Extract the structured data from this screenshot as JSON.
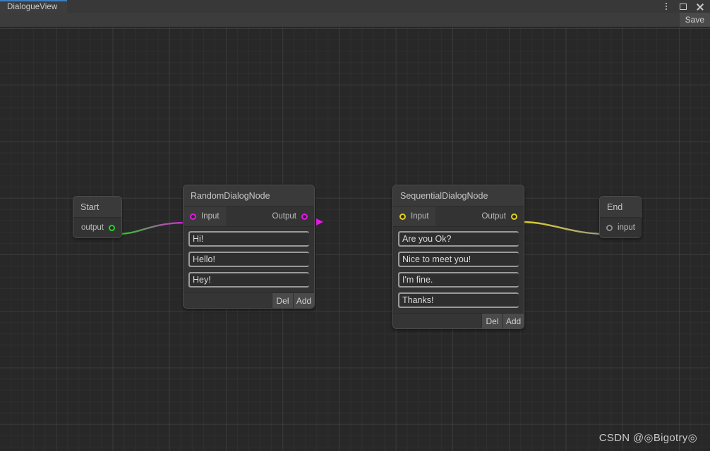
{
  "window": {
    "tab_label": "DialogueView",
    "menu_icon": "kebab-menu-icon",
    "maximize_icon": "maximize-icon",
    "close_icon": "close-icon"
  },
  "toolbar": {
    "save_label": "Save"
  },
  "colors": {
    "tab_accent": "#3e7fc1",
    "canvas_bg": "#282828",
    "node_bg": "#333333",
    "port_magenta": "#e519e5",
    "port_yellow": "#e2d023",
    "port_green": "#1fd81f",
    "port_grey": "#8e8e8e"
  },
  "graph": {
    "nodes": [
      {
        "id": "start",
        "title": "Start",
        "kind": "small",
        "output_label": "output",
        "output_color": "green"
      },
      {
        "id": "random",
        "title": "RandomDialogNode",
        "kind": "dialog",
        "input_label": "Input",
        "output_label": "Output",
        "port_color": "magenta",
        "entries": [
          "Hi!",
          "Hello!",
          "Hey!"
        ],
        "del_label": "Del",
        "add_label": "Add",
        "new_entry_value": "",
        "new_entry_placeholder": ""
      },
      {
        "id": "sequential",
        "title": "SequentialDialogNode",
        "kind": "dialog",
        "input_label": "Input",
        "output_label": "Output",
        "port_color": "yellow",
        "entries": [
          "Are you Ok?",
          "Nice to meet you!",
          "I'm fine.",
          "Thanks!"
        ],
        "del_label": "Del",
        "add_label": "Add",
        "new_entry_value": "",
        "new_entry_placeholder": ""
      },
      {
        "id": "end",
        "title": "End",
        "kind": "small",
        "input_label": "input",
        "input_color": "grey"
      }
    ],
    "edges": [
      {
        "from": "start",
        "to": "random",
        "from_color": "#1fd81f",
        "to_color": "#e519e5"
      },
      {
        "from": "random",
        "to": "sequential",
        "from_color": "#e519e5",
        "to_color": "#e2d023"
      },
      {
        "from": "sequential",
        "to": "end",
        "from_color": "#e2d023",
        "to_color": "#9a9a8e"
      }
    ]
  },
  "watermark": {
    "text": "CSDN @◎Bigotry◎"
  }
}
